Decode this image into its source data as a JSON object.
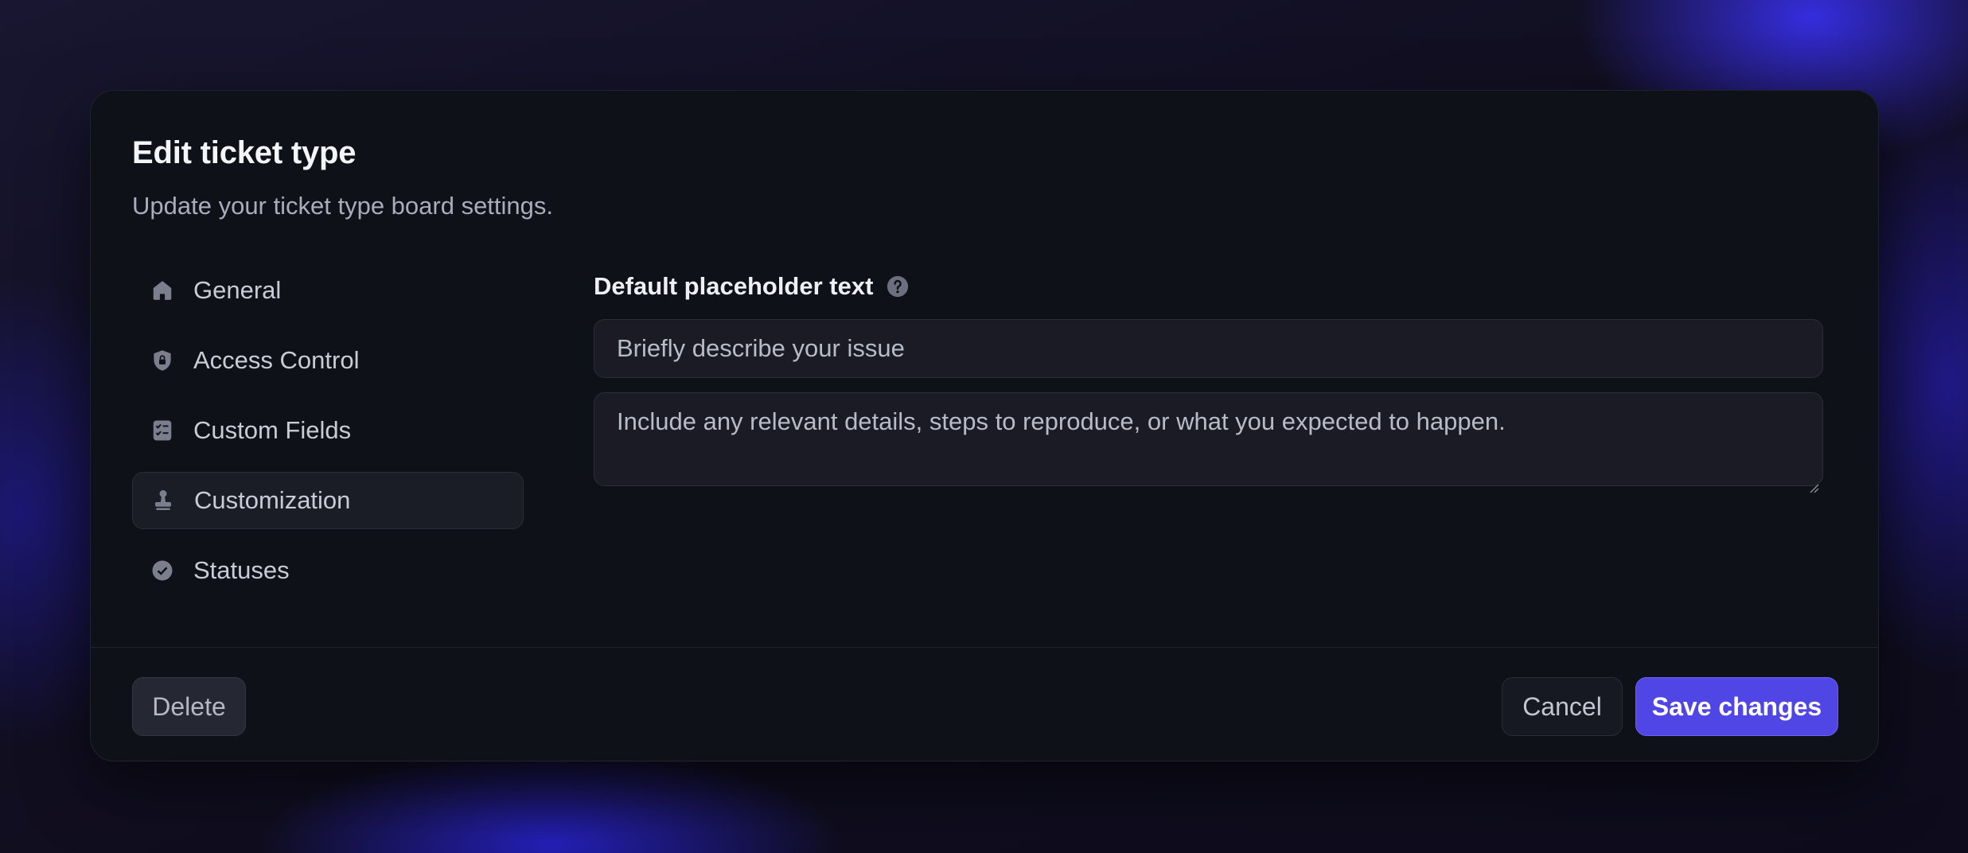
{
  "dialog": {
    "title": "Edit ticket type",
    "subtitle": "Update your ticket type board settings."
  },
  "nav": {
    "items": [
      {
        "label": "General",
        "icon": "home-icon",
        "active": false
      },
      {
        "label": "Access Control",
        "icon": "shield-lock-icon",
        "active": false
      },
      {
        "label": "Custom Fields",
        "icon": "checklist-icon",
        "active": false
      },
      {
        "label": "Customization",
        "icon": "stamp-icon",
        "active": true
      },
      {
        "label": "Statuses",
        "icon": "check-circle-icon",
        "active": false
      }
    ]
  },
  "form": {
    "field_label": "Default placeholder text",
    "help_icon": "question-circle-icon",
    "title_placeholder_value": "Briefly describe your issue",
    "description_placeholder_value": "Include any relevant details, steps to reproduce, or what you expected to happen."
  },
  "footer": {
    "delete_label": "Delete",
    "cancel_label": "Cancel",
    "save_label": "Save changes"
  },
  "colors": {
    "accent": "#4f46e5",
    "panel": "#0f1119",
    "icon": "#7a7e8d"
  }
}
